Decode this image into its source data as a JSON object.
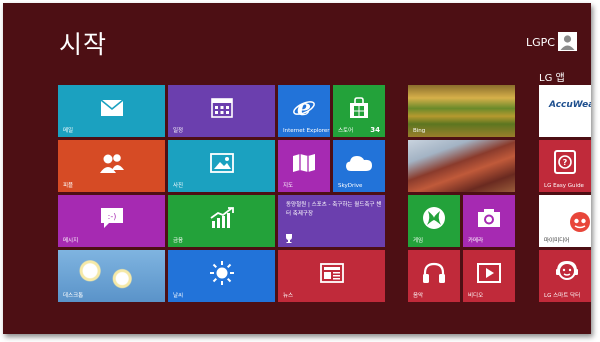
{
  "screen": {
    "title": "시작",
    "user_name": "LGPC",
    "group_label": "LG 앱"
  },
  "tiles": {
    "mail": "메일",
    "calendar": "일정",
    "ie": "Internet Explorer",
    "store": "스토어",
    "store_count": "34",
    "people": "피플",
    "photos": "사진",
    "maps": "지도",
    "skydrive": "SkyDrive",
    "messaging": "메시지",
    "finance": "금융",
    "news_headline": "동양철원 | 스포츠 - 축구하는 월드축구 챈터 축제구장",
    "desktop": "데스크톱",
    "weather": "날씨",
    "news": "뉴스",
    "bing": "Bing",
    "travel": "",
    "games": "게임",
    "camera": "카메라",
    "music": "음악",
    "video": "비디오",
    "accuweather": "AccuWea",
    "lg_easy_guide": "LG Easy Guide",
    "media": "마이미디어",
    "lg_smart_doctor": "LG 스마트 닥터"
  },
  "colors": {
    "background": "#4d0f14",
    "teal": "#1ba1c0",
    "purple": "#6b3fae",
    "blue": "#2273d9",
    "green": "#23a23a",
    "orange": "#d64b25",
    "magenta": "#a62ab2",
    "crimson": "#c02a3a",
    "dark_purple": "#6b2aaa"
  }
}
